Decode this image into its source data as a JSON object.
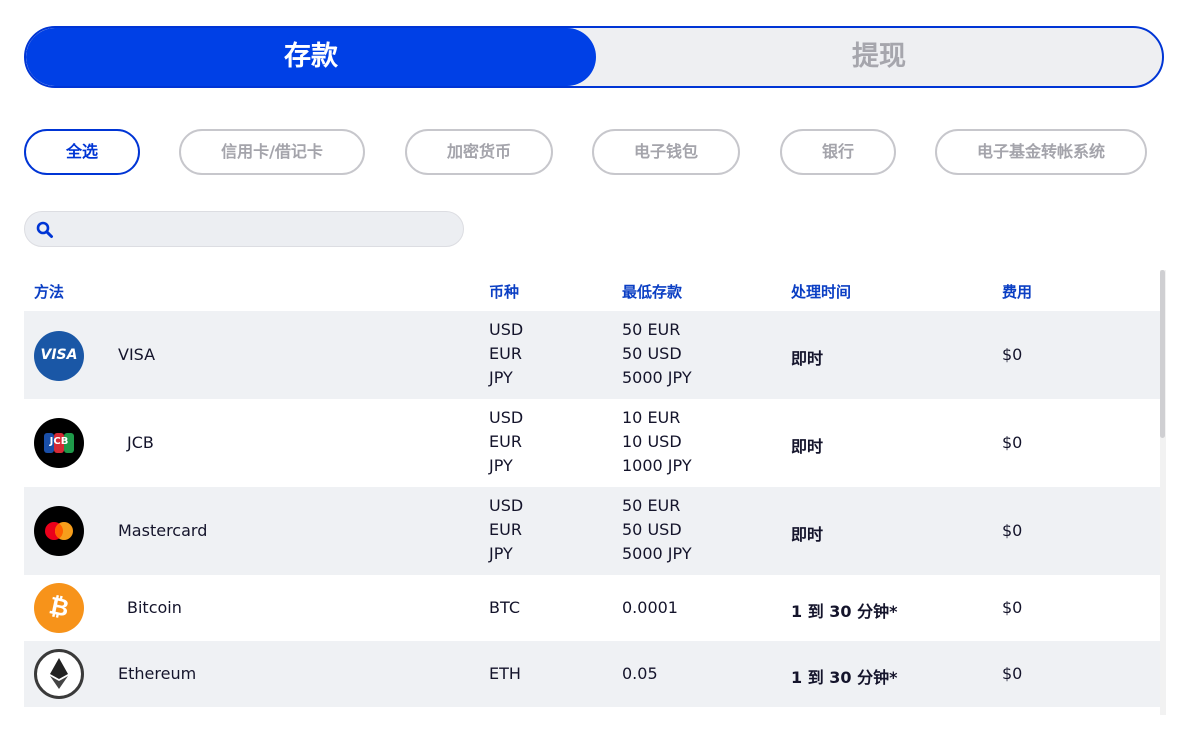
{
  "tabs": {
    "deposit": "存款",
    "withdraw": "提现"
  },
  "filters": [
    "全选",
    "信用卡/借记卡",
    "加密货币",
    "电子钱包",
    "银行",
    "电子基金转帐系统"
  ],
  "search": {
    "placeholder": "",
    "value": "",
    "icon": "search-icon"
  },
  "table": {
    "headers": {
      "method": "方法",
      "currency": "币种",
      "min_deposit": "最低存款",
      "processing_time": "处理时间",
      "fee": "费用"
    },
    "rows": [
      {
        "name": "VISA",
        "logo_text": "VISA",
        "currencies": [
          "USD",
          "EUR",
          "JPY"
        ],
        "min_deposit": [
          "50 EUR",
          "50 USD",
          "5000 JPY"
        ],
        "processing_time": "即时",
        "fee": "$0"
      },
      {
        "name": "JCB",
        "logo_text": "JCB",
        "currencies": [
          "USD",
          "EUR",
          "JPY"
        ],
        "min_deposit": [
          "10 EUR",
          "10 USD",
          "1000 JPY"
        ],
        "processing_time": "即时",
        "fee": "$0"
      },
      {
        "name": "Mastercard",
        "currencies": [
          "USD",
          "EUR",
          "JPY"
        ],
        "min_deposit": [
          "50 EUR",
          "50 USD",
          "5000 JPY"
        ],
        "processing_time": "即时",
        "fee": "$0"
      },
      {
        "name": "Bitcoin",
        "currencies": [
          "BTC"
        ],
        "min_deposit": [
          "0.0001"
        ],
        "processing_time": "1 到 30 分钟*",
        "fee": "$0"
      },
      {
        "name": "Ethereum",
        "currencies": [
          "ETH"
        ],
        "min_deposit": [
          "0.05"
        ],
        "processing_time": "1 到 30 分钟*",
        "fee": "$0"
      }
    ]
  },
  "colors": {
    "brand_blue": "#0040e6",
    "header_blue": "#0b3fc4",
    "row_shade": "#eff1f4",
    "visa_blue": "#1a57a6",
    "bitcoin_orange": "#f7931a"
  }
}
